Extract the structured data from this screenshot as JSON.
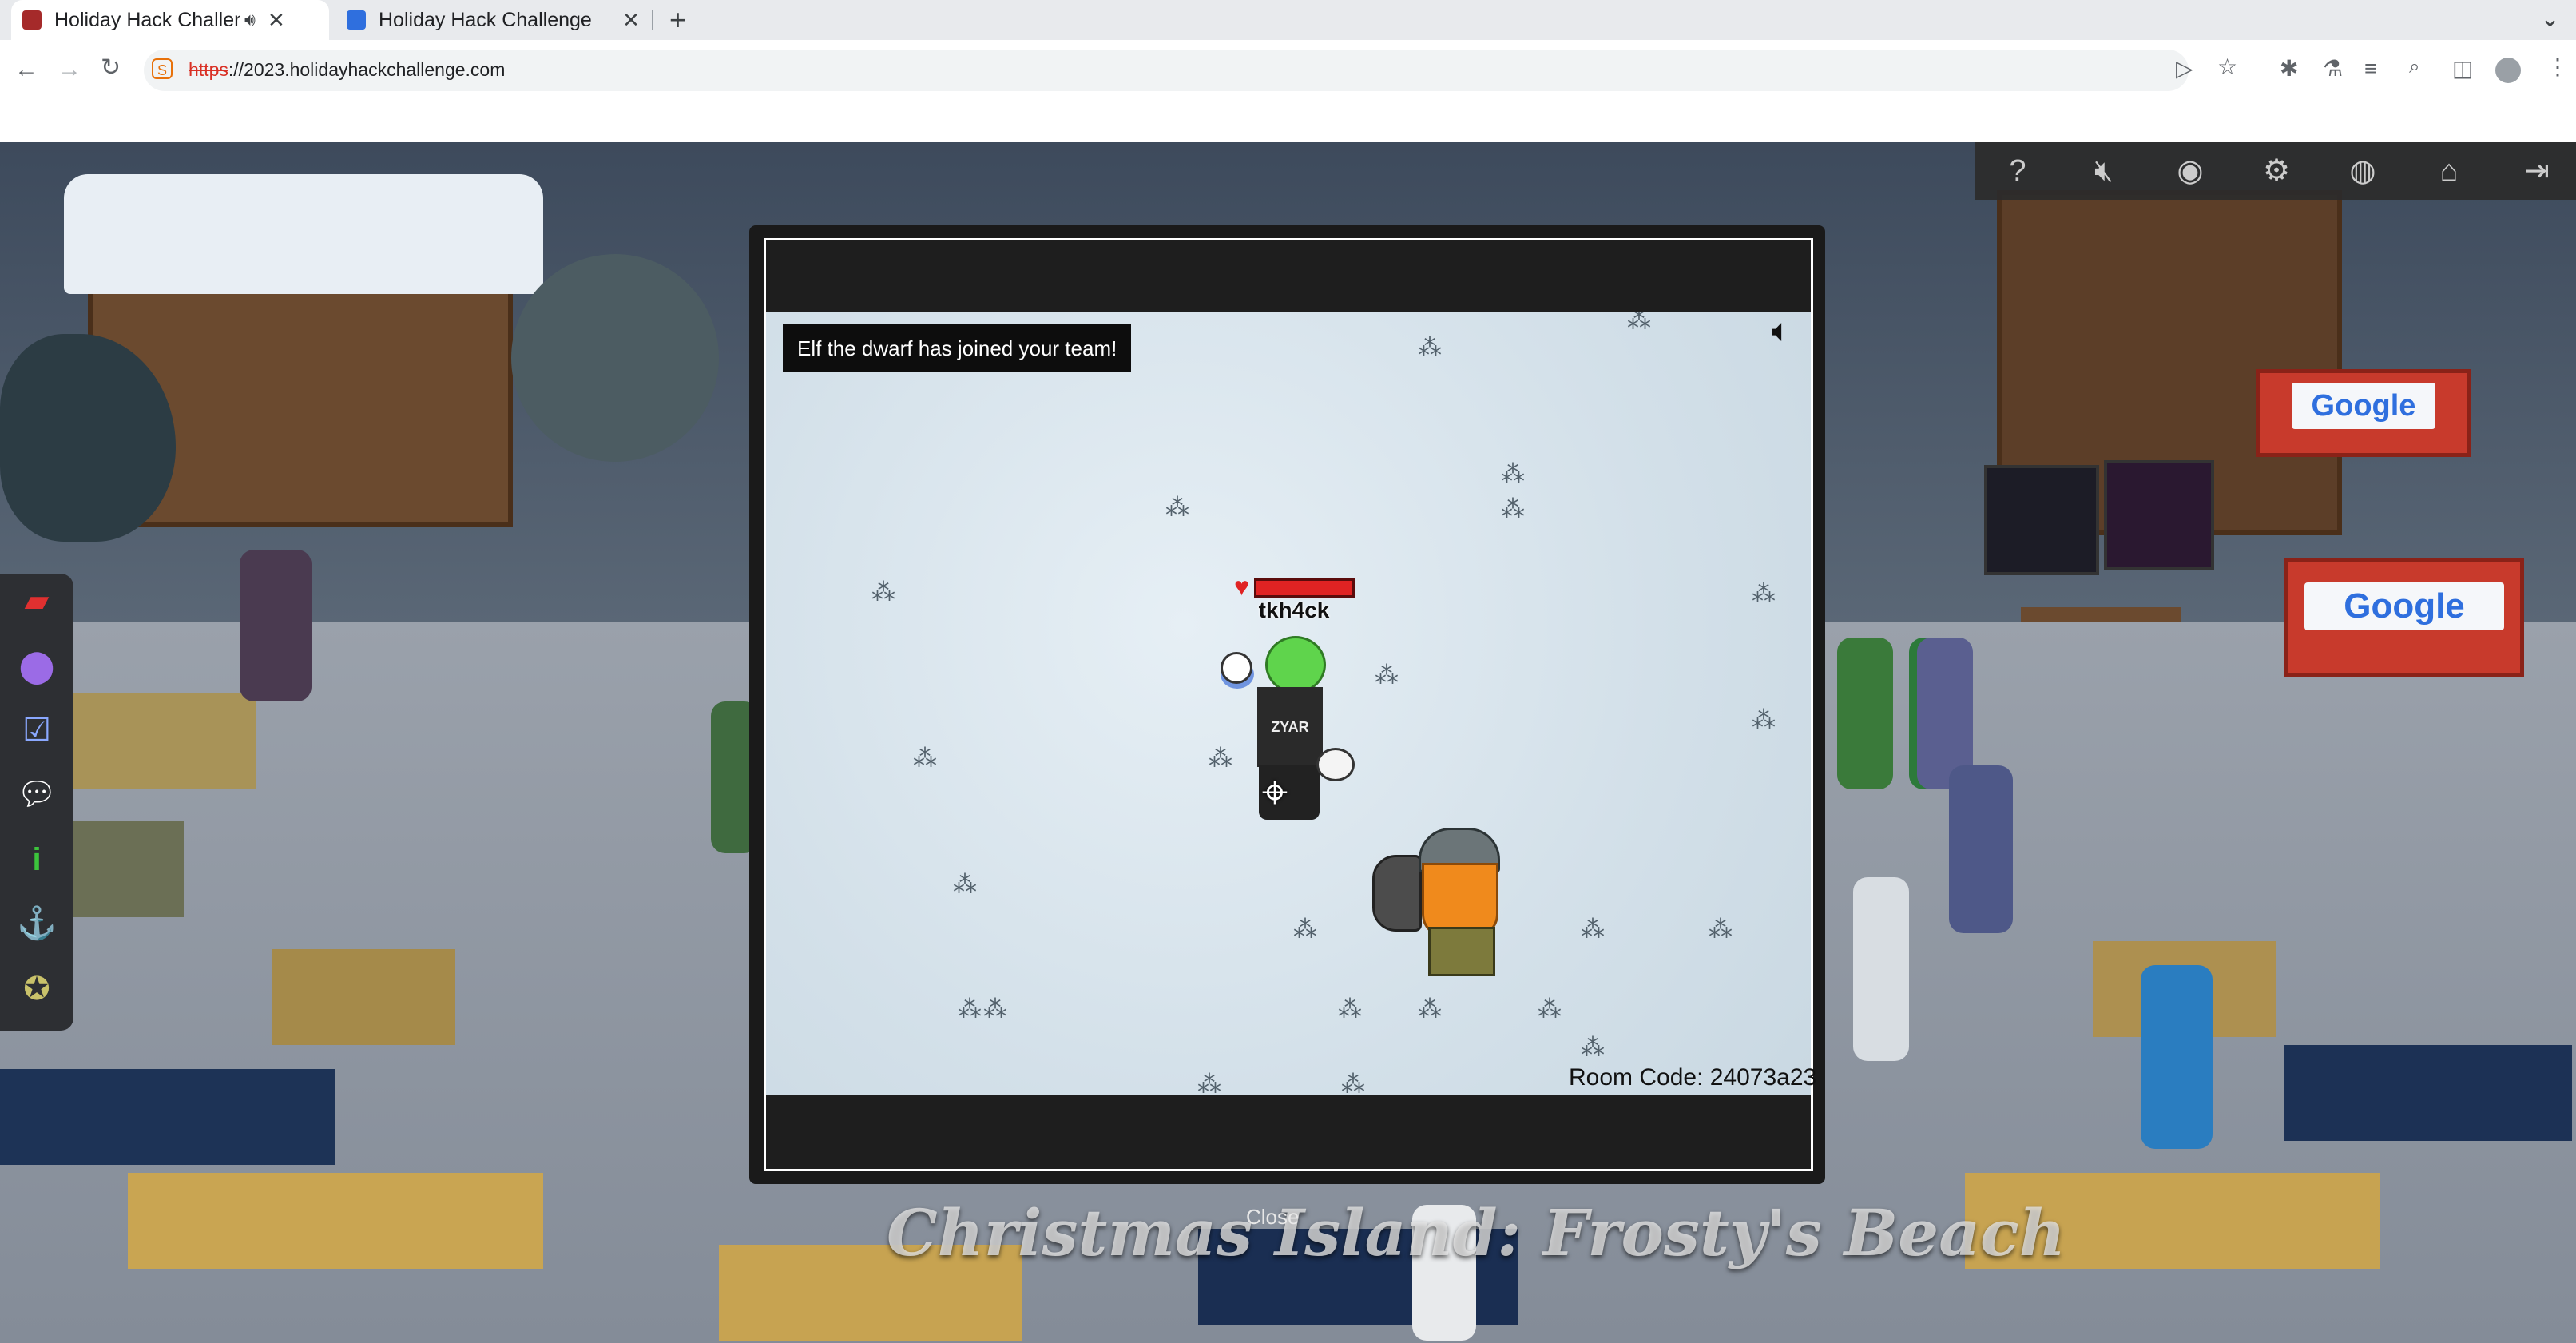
{
  "browser": {
    "tabs": [
      {
        "title": "Holiday Hack Challenge",
        "active": true,
        "favicon_color": "#a52a2a",
        "audio": true
      },
      {
        "title": "Holiday Hack Challenge",
        "active": false,
        "favicon_color": "#2f6fde"
      }
    ],
    "new_tab_symbol": "+",
    "tab_overflow_symbol": "⌄",
    "url_scheme": "https",
    "url_rest": "://2023.holidayhackchallenge.com",
    "toolbar_icons": [
      "cast-icon",
      "bookmark-star-icon",
      "extensions-icon",
      "labs-icon",
      "media-queue-icon",
      "zoom-icon",
      "side-panel-icon",
      "profile-icon",
      "menu-icon"
    ]
  },
  "game": {
    "toast": "Elf the dwarf has joined your team!",
    "player_name": "tkh4ck",
    "shirt_text": "ZYAR",
    "room_code": "Room Code: 24073a23",
    "close_label": "Close",
    "location_title": "Christmas Island: Frosty's Beach",
    "booth_sign": "Google",
    "top_menu_icons": [
      "help-icon",
      "mute-icon",
      "discord-icon",
      "settings-icon",
      "account-icon",
      "home-icon",
      "logout-icon"
    ],
    "sidebar_icons": [
      "book-icon",
      "map-pin-icon",
      "checklist-icon",
      "chat-icon",
      "info-icon",
      "anchor-icon",
      "achievement-icon"
    ]
  },
  "colors": {
    "hp": "#e02323",
    "player_head": "#5fd44c",
    "dwarf_beard": "#f08a1c",
    "booth": "#c83a2c"
  }
}
